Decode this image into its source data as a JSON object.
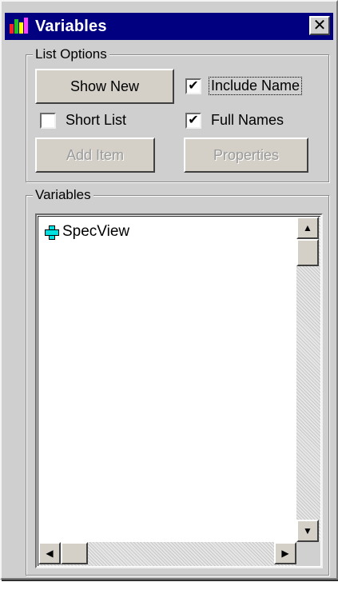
{
  "window": {
    "title": "Variables",
    "close_glyph": "✕",
    "app_icon": "variables-app-icon"
  },
  "list_options": {
    "legend": "List Options",
    "show_new_label": "Show New",
    "add_item_label": "Add Item",
    "properties_label": "Properties",
    "include_name": {
      "label": "Include Name",
      "checked": true
    },
    "short_list": {
      "label": "Short List",
      "checked": false
    },
    "full_names": {
      "label": "Full Names",
      "checked": true
    }
  },
  "variables_panel": {
    "legend": "Variables",
    "items": [
      {
        "label": "SpecView",
        "icon": "plus-expand-icon"
      }
    ]
  },
  "scrollbars": {
    "up_arrow": "▲",
    "down_arrow": "▼",
    "left_arrow": "◀",
    "right_arrow": "▶"
  },
  "colors": {
    "titlebar": "#000080",
    "face": "#cfcfcf",
    "plus_icon": "#00e0e0"
  }
}
